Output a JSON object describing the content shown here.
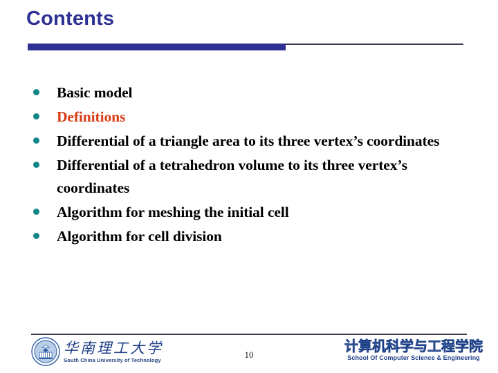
{
  "slide": {
    "title": "Contents",
    "page_number": "10",
    "title_color": "#2e3192",
    "accent_color": "#d93a14",
    "bullet_color": "#10868a"
  },
  "bullets": [
    {
      "text": "Basic model",
      "highlight": false
    },
    {
      "text": "Definitions",
      "highlight": true
    },
    {
      "text": "Differential of a triangle area to its three vertex’s coordinates",
      "highlight": false
    },
    {
      "text": "Differential of a tetrahedron volume to its three vertex’s coordinates",
      "highlight": false
    },
    {
      "text": "Algorithm for meshing the initial cell",
      "highlight": false
    },
    {
      "text": "Algorithm for cell division",
      "highlight": false
    }
  ],
  "footer": {
    "university": {
      "chinese": "华南理工大学",
      "english": "South China University of Technology"
    },
    "school": {
      "chinese": "计算机科学与工程学院",
      "english": "School Of Computer Science & Engineering"
    }
  }
}
